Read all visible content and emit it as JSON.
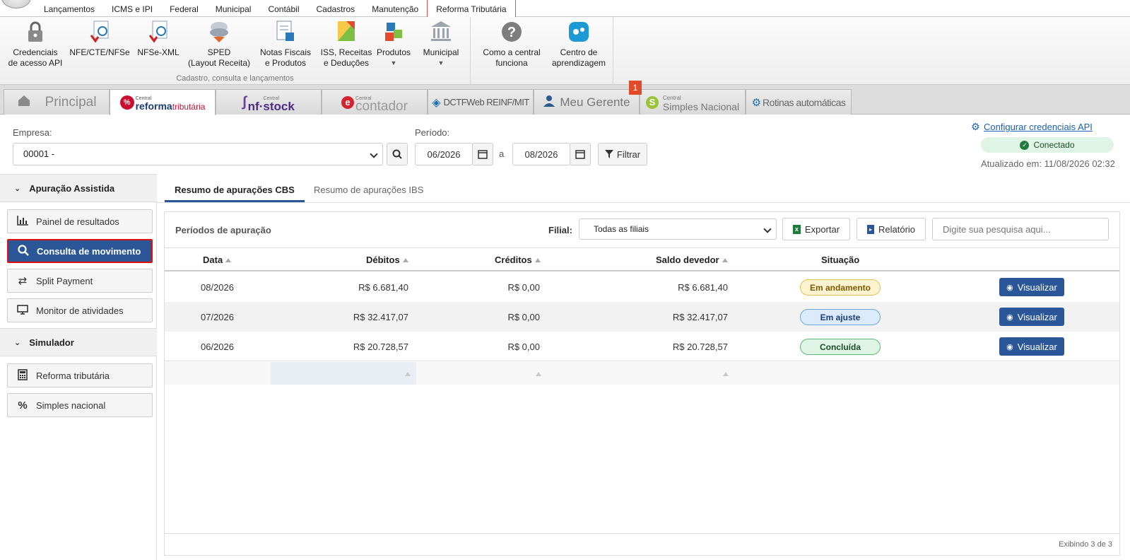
{
  "menu": {
    "tabs": [
      "Lançamentos",
      "ICMS e IPI",
      "Federal",
      "Municipal",
      "Contábil",
      "Cadastros",
      "Manutenção",
      "Reforma Tributária"
    ]
  },
  "ribbon": {
    "group1": {
      "buttons": [
        {
          "l1": "Credenciais",
          "l2": "de acesso API"
        },
        {
          "l1": "NFE/CTE/NFSe",
          "l2": ""
        },
        {
          "l1": "NFSe-XML",
          "l2": ""
        },
        {
          "l1": "SPED",
          "l2": "(Layout Receita)"
        },
        {
          "l1": "Notas Fiscais",
          "l2": "e Produtos"
        },
        {
          "l1": "ISS, Receitas",
          "l2": "e Deduções"
        },
        {
          "l1": "Produtos",
          "l2": ""
        },
        {
          "l1": "Municipal",
          "l2": ""
        }
      ],
      "label": "Cadastro, consulta e lançamentos"
    },
    "group2": {
      "buttons": [
        {
          "l1": "Como a central",
          "l2": "funciona"
        },
        {
          "l1": "Centro de",
          "l2": "aprendizagem"
        }
      ]
    }
  },
  "apptabs": {
    "principal": "Principal",
    "reforma_small": "Central",
    "reforma_a": "reforma",
    "reforma_b": "tributária",
    "nfstock_small": "Central",
    "nfstock": "nf·stock",
    "contador_small": "Central",
    "contador": "contador",
    "dctf": "DCTFWeb REINF/MIT",
    "gerente": "Meu Gerente",
    "simples_small": "Central",
    "simples": "Simples Nacional",
    "rotinas": "Rotinas automáticas",
    "notif_count": "1"
  },
  "filters": {
    "empresa_label": "Empresa:",
    "empresa_value": "00001 -",
    "periodo_label": "Período:",
    "periodo_from": "06/2026",
    "periodo_sep": "a",
    "periodo_to": "08/2026",
    "filtrar": "Filtrar"
  },
  "status": {
    "config_link": "Configurar credenciais API",
    "connected": "Conectado",
    "updated": "Atualizado em: 11/08/2026 02:32"
  },
  "sidebar": {
    "section1": "Apuração Assistida",
    "items1": [
      "Painel de resultados",
      "Consulta de movimento",
      "Split Payment",
      "Monitor de atividades"
    ],
    "section2": "Simulador",
    "items2": [
      "Reforma tributária",
      "Simples nacional"
    ]
  },
  "content_tabs": [
    "Resumo de apurações CBS",
    "Resumo de apurações IBS"
  ],
  "panel": {
    "title": "Períodos de apuração",
    "filial_label": "Filial:",
    "filial_value": "Todas as filiais",
    "exportar": "Exportar",
    "relatorio": "Relatório",
    "search_placeholder": "Digite sua pesquisa aqui...",
    "columns": [
      "Data",
      "Débitos",
      "Créditos",
      "Saldo devedor",
      "Situação"
    ],
    "rows": [
      {
        "data": "08/2026",
        "debitos": "R$ 6.681,40",
        "creditos": "R$ 0,00",
        "saldo": "R$ 6.681,40",
        "situacao": "Em andamento",
        "acao": "Visualizar"
      },
      {
        "data": "07/2026",
        "debitos": "R$ 32.417,07",
        "creditos": "R$ 0,00",
        "saldo": "R$ 32.417,07",
        "situacao": "Em ajuste",
        "acao": "Visualizar"
      },
      {
        "data": "06/2026",
        "debitos": "R$ 20.728,57",
        "creditos": "R$ 0,00",
        "saldo": "R$ 20.728,57",
        "situacao": "Concluída",
        "acao": "Visualizar"
      }
    ],
    "footer": "Exibindo 3 de 3"
  },
  "colors": {
    "accent": "#2b5799",
    "pill_andamento_bg": "#fdf3cf",
    "pill_ajuste_bg": "#dcebfb",
    "pill_concluida_bg": "#dff4e4"
  }
}
